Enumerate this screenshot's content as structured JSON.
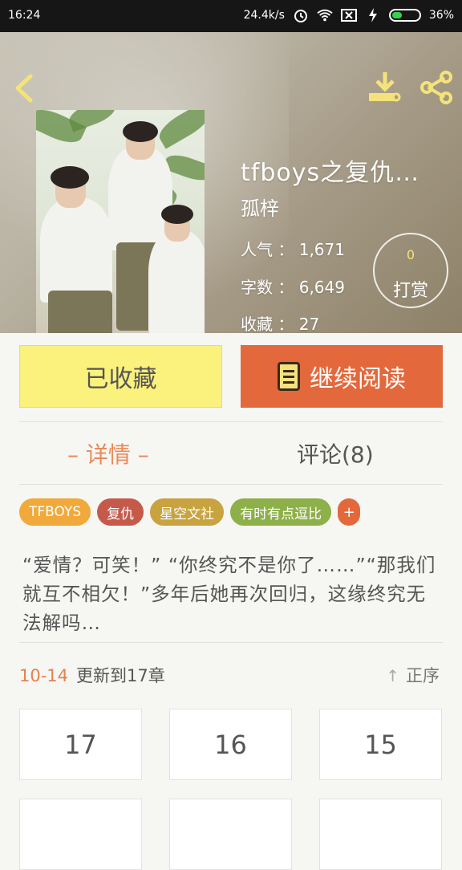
{
  "status_bar": {
    "time": "16:24",
    "speed": "24.4k/s",
    "battery_percent": "36%",
    "battery_level": 0.36
  },
  "book": {
    "title": "tfboys之复仇…",
    "author": "孤梓",
    "stats": [
      {
        "label": "人气",
        "value": "1,671"
      },
      {
        "label": "字数",
        "value": "6,649"
      },
      {
        "label": "收藏",
        "value": "27"
      }
    ],
    "reward": {
      "count": "0",
      "label": "打赏"
    }
  },
  "actions": {
    "favorited_label": "已收藏",
    "continue_label": "继续阅读"
  },
  "tabs": {
    "detail": "– 详情 –",
    "comments": "评论(8)"
  },
  "tags": [
    {
      "label": "TFBOYS",
      "color": "#f0a93a"
    },
    {
      "label": "复仇",
      "color": "#c65a4a"
    },
    {
      "label": "星空文社",
      "color": "#c8a33f"
    },
    {
      "label": "有时有点逗比",
      "color": "#8db04a"
    },
    {
      "label": "+",
      "color": "#e3683c"
    }
  ],
  "description": "“爱情？可笑！” “你终究不是你了……”“那我们就互不相欠！”多年后她再次回归，这缘终究无法解吗…",
  "update": {
    "date": "10-14",
    "text": "更新到17章",
    "order_label": "正序"
  },
  "chapters": [
    "17",
    "16",
    "15",
    "",
    "",
    ""
  ],
  "colors": {
    "accent_orange": "#e3683c",
    "favorite_yellow": "#fbf17d",
    "icon_yellow": "#f4e37a"
  }
}
